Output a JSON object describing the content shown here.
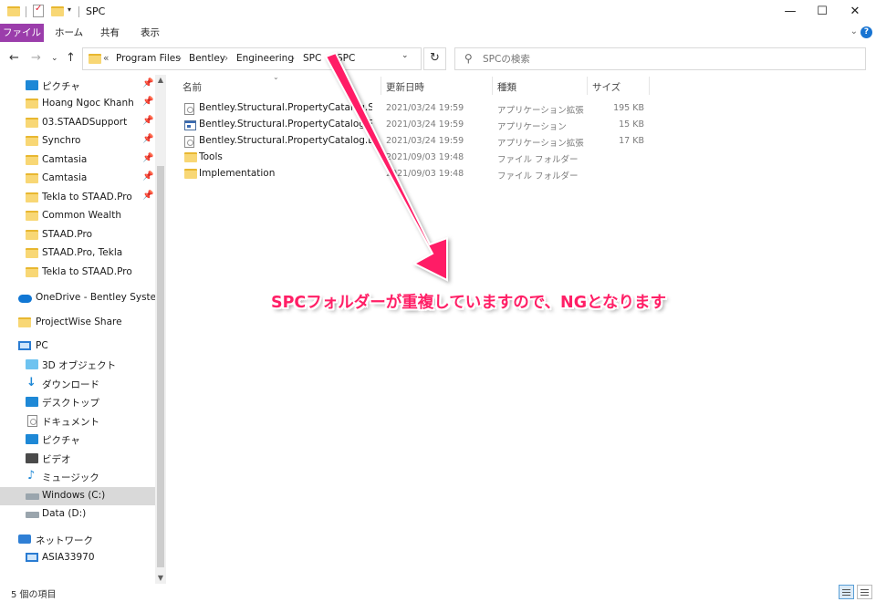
{
  "window": {
    "title": "SPC",
    "controls": {
      "minimize": "—",
      "maximize": "☐",
      "close": "✕"
    }
  },
  "ribbon": {
    "tabs": [
      "ファイル",
      "ホーム",
      "共有",
      "表示"
    ],
    "file_tab_color": "#9b3dab"
  },
  "address": {
    "chevron": "«",
    "crumbs": [
      "Program Files",
      "Bentley",
      "Engineering",
      "SPC",
      "SPC"
    ],
    "separator": "›"
  },
  "search": {
    "placeholder": "SPCの検索"
  },
  "navpane": {
    "quick_access": [
      {
        "label": "ピクチャ",
        "icon": "pictures-icon",
        "pinned": true
      },
      {
        "label": "Hoang Ngoc Khanh",
        "icon": "folder-icon",
        "pinned": true
      },
      {
        "label": "03.STAADSupport",
        "icon": "folder-icon",
        "pinned": true
      },
      {
        "label": "Synchro",
        "icon": "folder-icon",
        "pinned": true
      },
      {
        "label": "Camtasia",
        "icon": "folder-icon",
        "pinned": true
      },
      {
        "label": "Camtasia",
        "icon": "folder-icon",
        "pinned": true
      },
      {
        "label": "Tekla to STAAD.Pro",
        "icon": "folder-icon",
        "pinned": true
      },
      {
        "label": "Common Wealth",
        "icon": "folder-icon",
        "pinned": false
      },
      {
        "label": "STAAD.Pro",
        "icon": "folder-icon",
        "pinned": false
      },
      {
        "label": "STAAD.Pro, Tekla",
        "icon": "folder-icon",
        "pinned": false
      },
      {
        "label": "Tekla to STAAD.Pro",
        "icon": "folder-icon",
        "pinned": false
      }
    ],
    "onedrive": "OneDrive - Bentley Systems,",
    "projectwise": "ProjectWise Share",
    "pc": "PC",
    "pc_items": [
      {
        "label": "3D オブジェクト",
        "icon": "3d-objects-icon"
      },
      {
        "label": "ダウンロード",
        "icon": "downloads-icon"
      },
      {
        "label": "デスクトップ",
        "icon": "desktop-icon"
      },
      {
        "label": "ドキュメント",
        "icon": "documents-icon"
      },
      {
        "label": "ピクチャ",
        "icon": "pictures-icon"
      },
      {
        "label": "ビデオ",
        "icon": "videos-icon"
      },
      {
        "label": "ミュージック",
        "icon": "music-icon"
      },
      {
        "label": "Windows (C:)",
        "icon": "drive-c-icon"
      },
      {
        "label": "Data (D:)",
        "icon": "drive-d-icon"
      }
    ],
    "network": "ネットワーク",
    "network_items": [
      {
        "label": "ASIA33970",
        "icon": "computer-icon"
      }
    ]
  },
  "columns": {
    "name": "名前",
    "modified": "更新日時",
    "type": "種類",
    "size": "サイズ"
  },
  "files": [
    {
      "name": "Bentley.Structural.PropertyCatalog.Server...",
      "modified": "2021/03/24 19:59",
      "type": "アプリケーション拡張",
      "size": "195 KB",
      "icon": "dll-icon"
    },
    {
      "name": "Bentley.Structural.PropertyCatalog.Server",
      "modified": "2021/03/24 19:59",
      "type": "アプリケーション",
      "size": "15 KB",
      "icon": "exe-icon"
    },
    {
      "name": "Bentley.Structural.PropertyCatalog.DBDri...",
      "modified": "2021/03/24 19:59",
      "type": "アプリケーション拡張",
      "size": "17 KB",
      "icon": "dll-icon"
    },
    {
      "name": "Tools",
      "modified": "2021/09/03 19:48",
      "type": "ファイル フォルダー",
      "size": "",
      "icon": "folder-icon"
    },
    {
      "name": "Implementation",
      "modified": "2021/09/03 19:48",
      "type": "ファイル フォルダー",
      "size": "",
      "icon": "folder-icon"
    }
  ],
  "annotation": {
    "text": "SPCフォルダーが重複していますので、NGとなります",
    "color": "#ff1f66"
  },
  "status": {
    "item_count": "5 個の項目"
  }
}
